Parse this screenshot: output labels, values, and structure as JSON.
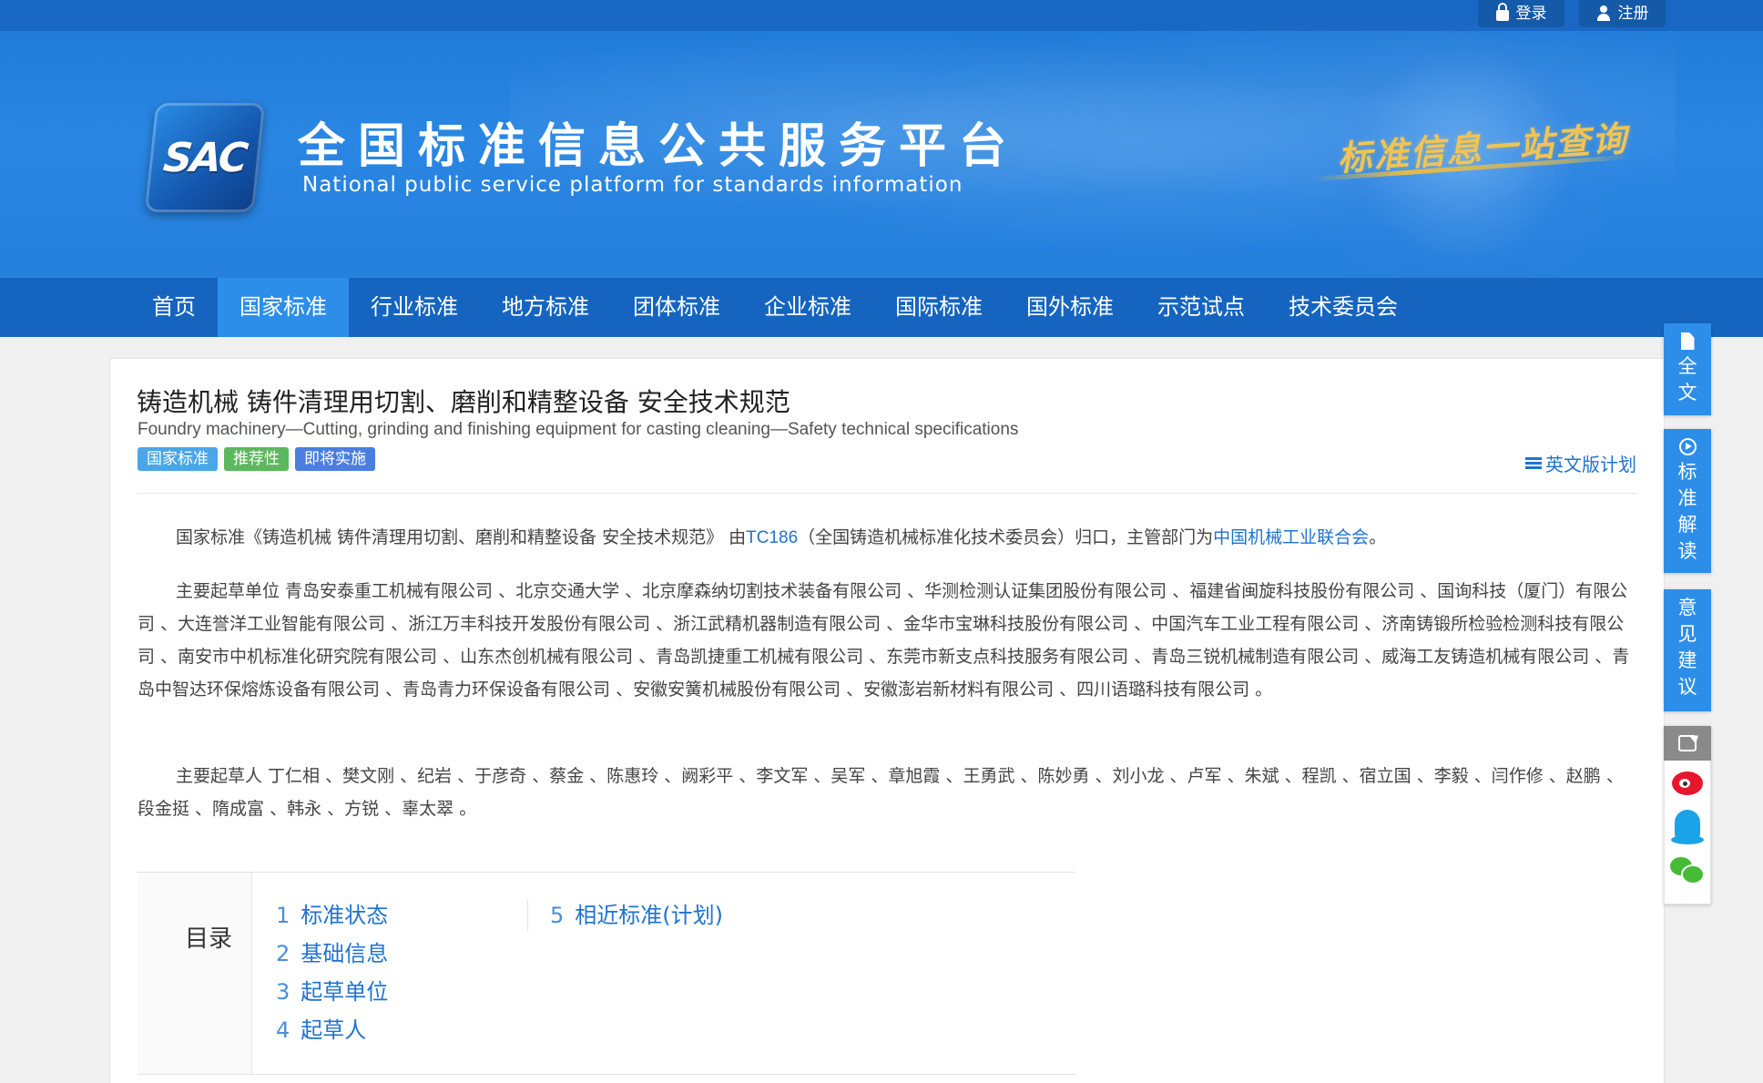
{
  "header": {
    "login_label": "登录",
    "register_label": "注册",
    "logo_text": "SAC",
    "site_title_cn": "全国标准信息公共服务平台",
    "site_title_en": "National public service platform  for standards information",
    "slogan": "标准信息一站查询"
  },
  "nav": {
    "items": [
      {
        "label": "首页"
      },
      {
        "label": "国家标准"
      },
      {
        "label": "行业标准"
      },
      {
        "label": "地方标准"
      },
      {
        "label": "团体标准"
      },
      {
        "label": "企业标准"
      },
      {
        "label": "国际标准"
      },
      {
        "label": "国外标准"
      },
      {
        "label": "示范试点"
      },
      {
        "label": "技术委员会"
      }
    ],
    "active": "国家标准"
  },
  "standard": {
    "title_cn": "铸造机械 铸件清理用切割、磨削和精整设备 安全技术规范",
    "title_en": "Foundry machinery—Cutting, grinding and finishing equipment for casting cleaning—Safety technical specifications",
    "badges": [
      "国家标准",
      "推荐性",
      "即将实施"
    ],
    "en_plan_label": "英文版计划",
    "intro": {
      "prefix": "国家标准《铸造机械 铸件清理用切割、磨削和精整设备 安全技术规范》 由",
      "tc_link": "TC186",
      "middle": "（全国铸造机械标准化技术委员会）归口，主管部门为",
      "dept_link": "中国机械工业联合会",
      "suffix": "。"
    },
    "drafting_units": "主要起草单位 青岛安泰重工机械有限公司 、北京交通大学 、北京摩森纳切割技术装备有限公司 、华测检测认证集团股份有限公司 、福建省闽旋科技股份有限公司 、国询科技（厦门）有限公司 、大连誉洋工业智能有限公司 、浙江万丰科技开发股份有限公司 、浙江武精机器制造有限公司 、金华市宝琳科技股份有限公司 、中国汽车工业工程有限公司 、济南铸锻所检验检测科技有限公司 、南安市中机标准化研究院有限公司 、山东杰创机械有限公司 、青岛凯捷重工机械有限公司 、东莞市新支点科技服务有限公司 、青岛三锐机械制造有限公司 、威海工友铸造机械有限公司 、青岛中智达环保熔炼设备有限公司 、青岛青力环保设备有限公司 、安徽安簧机械股份有限公司 、安徽澎岩新材料有限公司 、四川语璐科技有限公司 。",
    "drafters": "主要起草人 丁仁相 、樊文刚 、纪岩 、于彦奇 、蔡金 、陈惠玲 、阙彩平 、李文军 、吴军 、章旭霞 、王勇武 、陈妙勇 、刘小龙 、卢军 、朱斌 、程凯 、宿立国 、李毅 、闫作修 、赵鹏 、段金挺 、隋成富 、韩永 、方锐 、辜太翠 。"
  },
  "toc": {
    "label": "目录",
    "col1": [
      {
        "num": "1",
        "label": "标准状态"
      },
      {
        "num": "2",
        "label": "基础信息"
      },
      {
        "num": "3",
        "label": "起草单位"
      },
      {
        "num": "4",
        "label": "起草人"
      }
    ],
    "col2": [
      {
        "num": "5",
        "label": "相近标准(计划)"
      }
    ]
  },
  "sidebar": {
    "fulltext": [
      "全",
      "文"
    ],
    "interpret": [
      "标",
      "准",
      "解",
      "读"
    ],
    "feedback": [
      "意",
      "见",
      "建",
      "议"
    ]
  },
  "colors": {
    "banner": "#2580dc",
    "nav": "#1565c0",
    "nav_active": "#2d8eea",
    "link": "#1f73d0",
    "badge_national": "#4aa6e8",
    "badge_recommended": "#5cb85c",
    "badge_upcoming": "#4a7fe0"
  }
}
